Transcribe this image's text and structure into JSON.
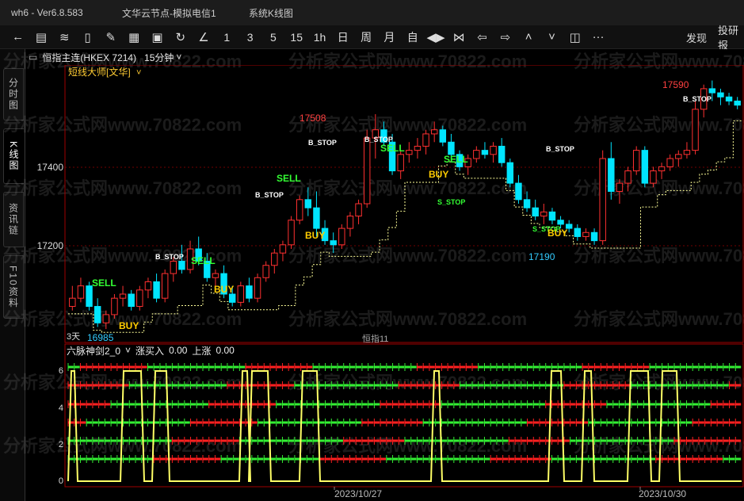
{
  "titlebar": {
    "version": "wh6  -  Ver6.8.583",
    "account": "文华云节点-模拟电信1",
    "window": "系统K线图"
  },
  "toolbar": {
    "icons": [
      "back-arrow-icon",
      "list-icon",
      "line-chart-icon",
      "candlestick-icon",
      "pen-icon",
      "report-icon",
      "save-icon",
      "refresh-icon",
      "draw-line-icon"
    ],
    "periods": [
      "1",
      "3",
      "5",
      "15",
      "1h",
      "日",
      "周",
      "月",
      "自"
    ],
    "nav_icons": [
      "left-right-icon",
      "bowtie-icon",
      "arrow-left-icon",
      "arrow-right-icon",
      "chevron-up-icon",
      "chevron-down-icon",
      "layout-icon"
    ],
    "more": "···",
    "discover": "发现",
    "research": "投研报"
  },
  "sidebar": {
    "tabs": [
      "分时图",
      "K线图",
      "资讯链",
      "F10资料"
    ],
    "active": 1
  },
  "header": {
    "contract": "恒指主连(HKEX 7214)",
    "period": "15分钟"
  },
  "main_chart": {
    "indicator": "短线大师[文华]",
    "y_labels": [
      "17400",
      "17200"
    ],
    "highest": "17590",
    "lowest": "16985",
    "mark_17508": "17508",
    "mark_17190": "17190",
    "day_label": "3天",
    "center_label": "恒指11",
    "signals": {
      "sell": "SELL",
      "buy": "BUY",
      "b_stop": "B_STOP",
      "s_stop": "S_STOP"
    }
  },
  "sub_chart": {
    "indicator": "六脉神剑2_0",
    "field1_label": "涨买入",
    "field1_value": "0.00",
    "field2_label": "上涨",
    "field2_value": "0.00",
    "y_labels": [
      "6",
      "4",
      "2",
      "0"
    ],
    "dates": [
      "2023/10/27",
      "2023/10/30"
    ]
  },
  "watermark": "分析家公式网www.70822.com",
  "colors": {
    "up": "#ff3030",
    "down": "#00e5ff",
    "ma": "#ffff66",
    "sell": "#33ff33",
    "buy": "#ffcc00",
    "bstop": "#ffffff",
    "frame": "#a00000"
  },
  "chart_data": {
    "type": "candlestick",
    "y_range": [
      16960,
      17620
    ],
    "bars": [
      [
        17040,
        17090,
        17030,
        17060
      ],
      [
        17060,
        17110,
        17050,
        17090
      ],
      [
        17090,
        17100,
        17030,
        17040
      ],
      [
        17040,
        17060,
        16990,
        17000
      ],
      [
        17000,
        17030,
        16985,
        17020
      ],
      [
        17020,
        17070,
        17010,
        17060
      ],
      [
        17060,
        17090,
        17040,
        17070
      ],
      [
        17070,
        17080,
        17030,
        17040
      ],
      [
        17040,
        17090,
        17030,
        17080
      ],
      [
        17080,
        17110,
        17060,
        17100
      ],
      [
        17100,
        17120,
        17050,
        17060
      ],
      [
        17060,
        17130,
        17050,
        17120
      ],
      [
        17120,
        17160,
        17100,
        17150
      ],
      [
        17150,
        17190,
        17120,
        17130
      ],
      [
        17130,
        17200,
        17120,
        17180
      ],
      [
        17180,
        17210,
        17140,
        17150
      ],
      [
        17150,
        17170,
        17100,
        17110
      ],
      [
        17110,
        17130,
        17080,
        17120
      ],
      [
        17120,
        17140,
        17060,
        17070
      ],
      [
        17070,
        17090,
        17040,
        17050
      ],
      [
        17050,
        17100,
        17040,
        17090
      ],
      [
        17090,
        17110,
        17050,
        17060
      ],
      [
        17060,
        17120,
        17050,
        17110
      ],
      [
        17110,
        17150,
        17100,
        17140
      ],
      [
        17140,
        17180,
        17120,
        17170
      ],
      [
        17170,
        17200,
        17150,
        17190
      ],
      [
        17190,
        17260,
        17180,
        17250
      ],
      [
        17250,
        17310,
        17240,
        17300
      ],
      [
        17300,
        17330,
        17260,
        17280
      ],
      [
        17280,
        17320,
        17210,
        17230
      ],
      [
        17230,
        17250,
        17190,
        17200
      ],
      [
        17200,
        17220,
        17170,
        17190
      ],
      [
        17190,
        17240,
        17180,
        17230
      ],
      [
        17230,
        17270,
        17210,
        17260
      ],
      [
        17260,
        17300,
        17240,
        17290
      ],
      [
        17290,
        17470,
        17280,
        17450
      ],
      [
        17450,
        17508,
        17400,
        17470
      ],
      [
        17470,
        17490,
        17430,
        17440
      ],
      [
        17440,
        17460,
        17360,
        17370
      ],
      [
        17370,
        17420,
        17350,
        17410
      ],
      [
        17410,
        17440,
        17390,
        17420
      ],
      [
        17420,
        17450,
        17400,
        17430
      ],
      [
        17430,
        17470,
        17410,
        17460
      ],
      [
        17460,
        17490,
        17440,
        17470
      ],
      [
        17470,
        17480,
        17430,
        17440
      ],
      [
        17440,
        17460,
        17400,
        17410
      ],
      [
        17410,
        17420,
        17370,
        17380
      ],
      [
        17380,
        17410,
        17360,
        17400
      ],
      [
        17400,
        17430,
        17390,
        17420
      ],
      [
        17420,
        17440,
        17400,
        17410
      ],
      [
        17410,
        17440,
        17390,
        17430
      ],
      [
        17430,
        17450,
        17380,
        17390
      ],
      [
        17390,
        17400,
        17330,
        17340
      ],
      [
        17340,
        17360,
        17290,
        17300
      ],
      [
        17300,
        17320,
        17270,
        17280
      ],
      [
        17280,
        17300,
        17250,
        17260
      ],
      [
        17260,
        17290,
        17240,
        17270
      ],
      [
        17270,
        17280,
        17240,
        17250
      ],
      [
        17250,
        17260,
        17230,
        17240
      ],
      [
        17240,
        17250,
        17220,
        17230
      ],
      [
        17230,
        17240,
        17200,
        17210
      ],
      [
        17210,
        17230,
        17200,
        17220
      ],
      [
        17220,
        17230,
        17190,
        17200
      ],
      [
        17200,
        17420,
        17190,
        17400
      ],
      [
        17400,
        17440,
        17300,
        17320
      ],
      [
        17320,
        17350,
        17290,
        17340
      ],
      [
        17340,
        17380,
        17320,
        17370
      ],
      [
        17370,
        17430,
        17360,
        17420
      ],
      [
        17420,
        17430,
        17330,
        17340
      ],
      [
        17340,
        17380,
        17330,
        17370
      ],
      [
        17370,
        17390,
        17350,
        17380
      ],
      [
        17380,
        17410,
        17370,
        17400
      ],
      [
        17400,
        17420,
        17380,
        17410
      ],
      [
        17410,
        17440,
        17400,
        17420
      ],
      [
        17420,
        17540,
        17410,
        17520
      ],
      [
        17520,
        17580,
        17500,
        17570
      ],
      [
        17570,
        17590,
        17540,
        17560
      ],
      [
        17560,
        17570,
        17530,
        17550
      ],
      [
        17550,
        17560,
        17530,
        17540
      ],
      [
        17540,
        17550,
        17520,
        17530
      ]
    ]
  }
}
